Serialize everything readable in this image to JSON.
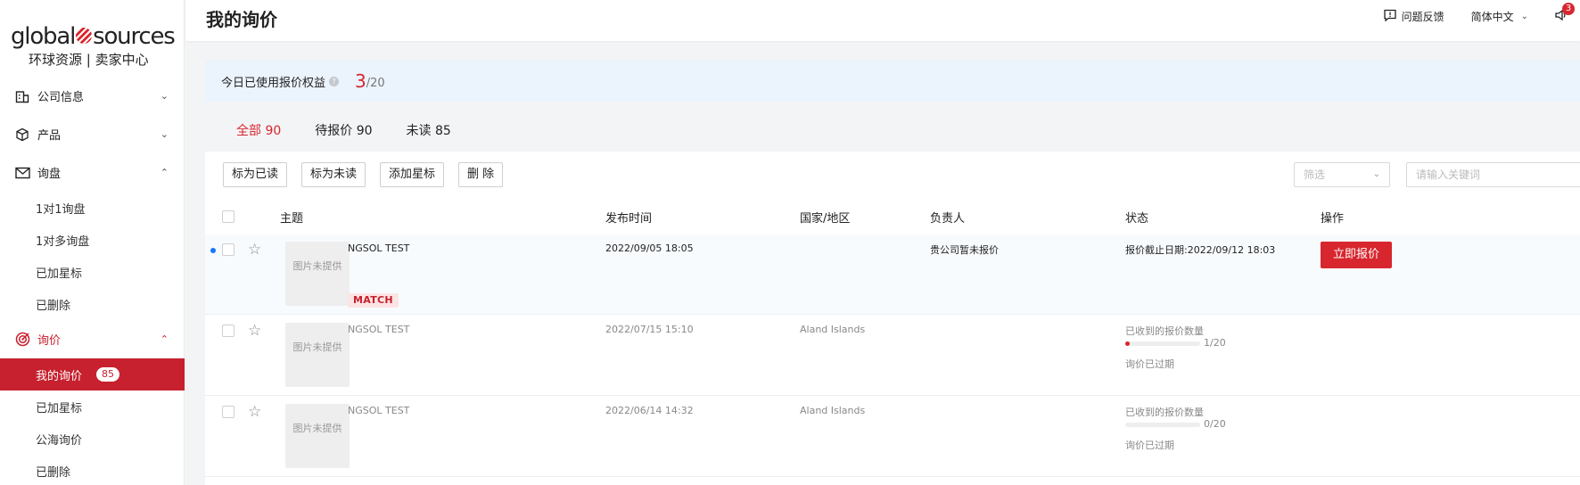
{
  "sidebar": {
    "logo_main_left": "global",
    "logo_main_right": "sources",
    "logo_sub": "环球资源 | 卖家中心",
    "groups": [
      {
        "label": "公司信息"
      },
      {
        "label": "产品"
      },
      {
        "label": "询盘"
      },
      {
        "label": "询价"
      }
    ],
    "inquiry_items": [
      "1对1询盘",
      "1对多询盘",
      "已加星标",
      "已删除"
    ],
    "rfq_items": [
      "我的询价",
      "已加星标",
      "公海询价",
      "已删除"
    ],
    "my_rfq_badge": "85"
  },
  "header": {
    "title": "我的询价",
    "feedback": "问题反馈",
    "language": "简体中文",
    "notification_count": "3"
  },
  "quota": {
    "label": "今日已使用报价权益",
    "used": "3",
    "total": "/20"
  },
  "tabs": [
    {
      "label": "全部 90",
      "active": true
    },
    {
      "label": "待报价 90",
      "active": false
    },
    {
      "label": "未读 85",
      "active": false
    }
  ],
  "toolbar": {
    "mark_read": "标为已读",
    "mark_unread": "标为未读",
    "add_star": "添加星标",
    "delete": "删 除",
    "filter_placeholder": "筛选",
    "keyword_placeholder": "请输入关键词"
  },
  "table": {
    "headers": {
      "subject": "主题",
      "published": "发布时间",
      "country": "国家/地区",
      "owner": "负责人",
      "status": "状态",
      "action": "操作"
    },
    "rows": [
      {
        "thumb": "图片未提供",
        "subject": "NGSOL TEST",
        "tag": "MATCH",
        "published": "2022/09/05 18:05",
        "country": "",
        "owner": "贵公司暂未报价",
        "status": "报价截止日期:2022/09/12 18:03",
        "action": "立即报价",
        "unread": true
      },
      {
        "thumb": "图片未提供",
        "subject": "NGSOL TEST",
        "published": "2022/07/15 15:10",
        "country": "Aland Islands",
        "owner": "",
        "status_label": "已收到的报价数量",
        "progress_text": "1/20",
        "progress_fraction": 0.05,
        "expired": "询价已过期",
        "unread": false
      },
      {
        "thumb": "图片未提供",
        "subject": "NGSOL TEST",
        "published": "2022/06/14 14:32",
        "country": "Aland Islands",
        "owner": "",
        "status_label": "已收到的报价数量",
        "progress_text": "0/20",
        "progress_fraction": 0,
        "expired": "询价已过期",
        "unread": false
      }
    ]
  },
  "colors": {
    "brand_red": "#d8262e",
    "unread_dot": "#1677ff",
    "quota_bg": "#ebf3fd"
  }
}
